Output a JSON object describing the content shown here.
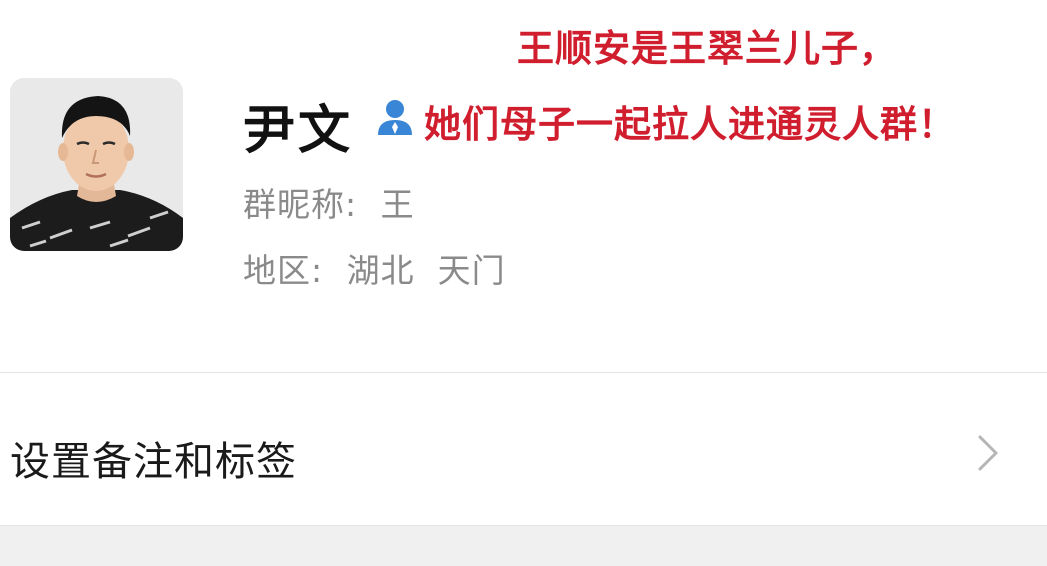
{
  "annotations": {
    "line1": "王顺安是王翠兰儿子，",
    "line2": "她们母子一起拉人进通灵人群！",
    "color": "#d01e2e"
  },
  "profile": {
    "avatar_icon": "avatar",
    "name": "尹文",
    "person_icon": "person-icon",
    "nickname_label": "群昵称:",
    "nickname_value": "王",
    "region_label": "地区:",
    "region_value": "湖北  天门"
  },
  "settings": {
    "label": "设置备注和标签",
    "chevron_icon": "chevron-right-icon"
  },
  "colors": {
    "accent_blue": "#3a86d6",
    "text_secondary": "#8a8a8a"
  }
}
